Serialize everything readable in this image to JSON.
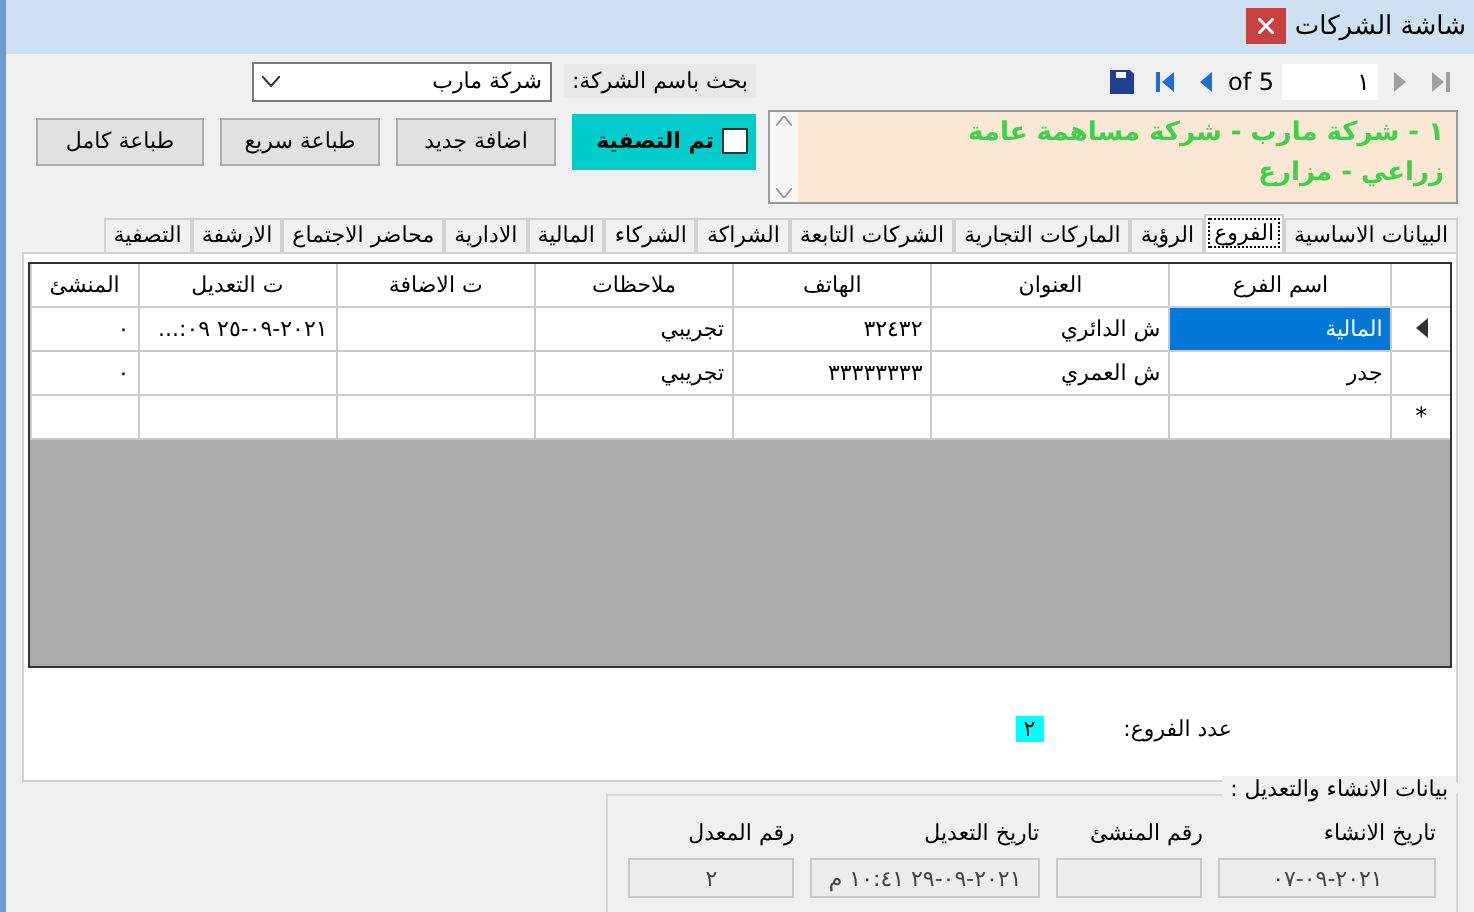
{
  "window": {
    "title": "شاشة الشركات"
  },
  "navigator": [
    {
      "kind": "last",
      "disabled": true
    },
    {
      "kind": "next",
      "disabled": true
    },
    {
      "kind": "record",
      "text": "١"
    },
    {
      "kind": "total",
      "text": "of 5"
    },
    {
      "kind": "previous",
      "disabled": false
    },
    {
      "kind": "first",
      "disabled": false
    },
    {
      "kind": "save",
      "disabled": false
    }
  ],
  "search": {
    "label": "بحث باسم الشركة:",
    "value": "شركة مارب"
  },
  "summary": {
    "lines": [
      "١ - شركة مارب - شركة مساهمة عامة",
      "زراعي - مزارع"
    ]
  },
  "settled": {
    "label": "تم التصفية",
    "checked": false
  },
  "buttons": [
    "اضافة جديد",
    "طباعة سريع",
    "طباعة كامل"
  ],
  "tabs": [
    {
      "label": "البيانات الاساسية",
      "selected": false
    },
    {
      "label": "الفروع",
      "selected": true
    },
    {
      "label": "الرؤية",
      "selected": false
    },
    {
      "label": "الماركات التجارية",
      "selected": false
    },
    {
      "label": "الشركات التابعة",
      "selected": false
    },
    {
      "label": "الشراكة",
      "selected": false
    },
    {
      "label": "الشركاء",
      "selected": false
    },
    {
      "label": "المالية",
      "selected": false
    },
    {
      "label": "الادارية",
      "selected": false
    },
    {
      "label": "محاضر الاجتماع",
      "selected": false
    },
    {
      "label": "الارشفة",
      "selected": false
    },
    {
      "label": "التصفية",
      "selected": false
    }
  ],
  "grid": {
    "columns": [
      "اسم الفرع",
      "العنوان",
      "الهاتف",
      "ملاحظات",
      "ت الاضافة",
      "ت التعديل",
      "المنشئ"
    ],
    "rows": [
      {
        "current": true,
        "cells": [
          {
            "kind": "text",
            "text": "المالية",
            "selected": true
          },
          {
            "kind": "text",
            "text": "ش الدائري",
            "selected": false
          },
          {
            "kind": "text",
            "text": "٣٢٤٣٢",
            "selected": false
          },
          {
            "kind": "text",
            "text": "تجريبي",
            "selected": false
          },
          {
            "kind": "empty",
            "selected": false
          },
          {
            "kind": "date",
            "text": "...:٠٩ ٢٥-٠٩-٢٠٢١",
            "selected": false
          },
          {
            "kind": "text",
            "text": "٠",
            "selected": false
          }
        ]
      },
      {
        "current": false,
        "cells": [
          {
            "kind": "text",
            "text": "جدر",
            "selected": false
          },
          {
            "kind": "text",
            "text": "ش العمري",
            "selected": false
          },
          {
            "kind": "text",
            "text": "٣٣٣٣٣٣٣٣",
            "selected": false
          },
          {
            "kind": "text",
            "text": "تجريبي",
            "selected": false
          },
          {
            "kind": "empty",
            "selected": false
          },
          {
            "kind": "empty",
            "selected": false
          },
          {
            "kind": "text",
            "text": "٠",
            "selected": false
          }
        ]
      }
    ],
    "new_row_marker": "*"
  },
  "branch_count": {
    "label": "عدد الفروع:",
    "value": "٢"
  },
  "audit": {
    "title": "بيانات الانشاء والتعديل :",
    "fields": [
      {
        "label": "تاريخ الانشاء",
        "value": "٠٧-٠٩-٢٠٢١"
      },
      {
        "label": "رقم المنشئ"
      },
      {
        "label": "تاريخ التعديل",
        "value": "م ١٠:٤١ ٢٩-٠٩-٢٠٢١"
      },
      {
        "label": "رقم المعدل",
        "value": "٢"
      }
    ]
  }
}
